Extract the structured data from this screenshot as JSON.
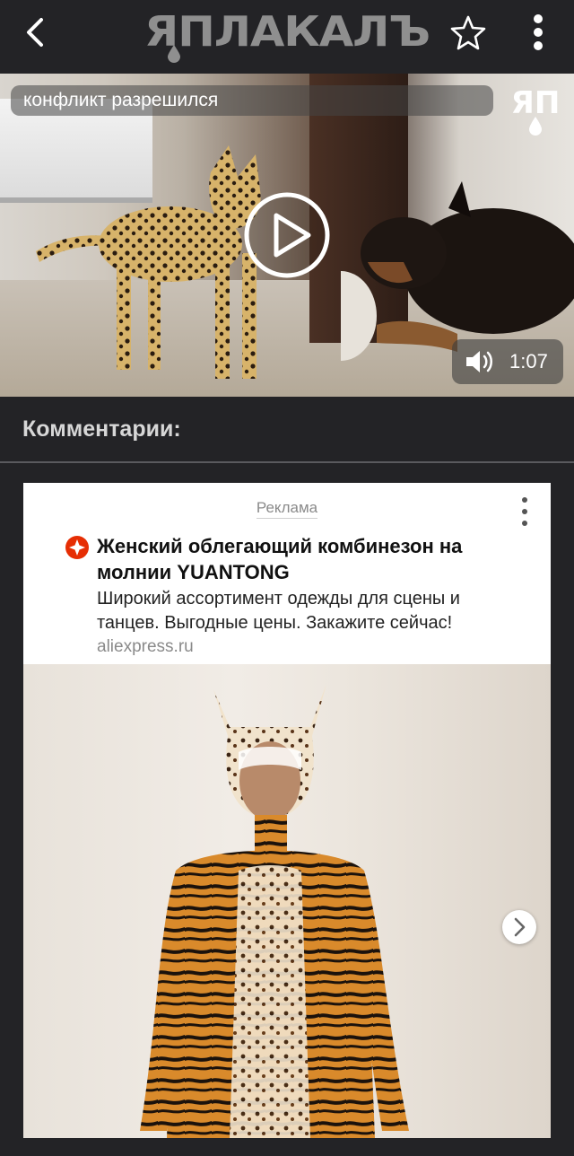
{
  "header": {
    "back_icon": "chevron-left-icon",
    "logo_text": "ЯПЛАКАЛЪ",
    "star_icon": "star-outline-icon",
    "more_icon": "more-vertical-icon"
  },
  "video": {
    "title": "конфликт разрешился",
    "watermark_text": "ЯП",
    "duration": "1:07",
    "play_icon": "play-icon",
    "volume_icon": "volume-icon"
  },
  "comments": {
    "title": "Комментарии:"
  },
  "ad": {
    "label": "Реклама",
    "title": "Женский облегающий комбинезон на молнии YUANTONG",
    "description": "Широкий ассортимент одежды для сцены и танцев. Выгодные цены. Закажите сейчас!",
    "domain": "aliexpress.ru",
    "brand_icon": "aliexpress-icon",
    "brand_color": "#e62e04",
    "next_icon": "chevron-right-icon"
  }
}
